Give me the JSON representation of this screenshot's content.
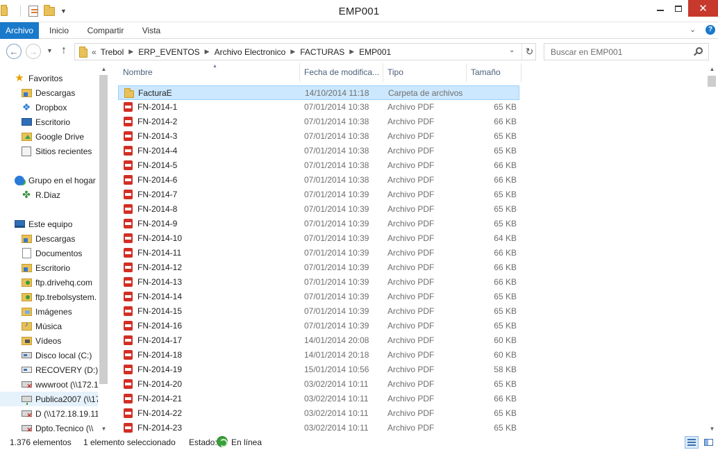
{
  "window": {
    "title": "EMP001",
    "close_glyph": "✕"
  },
  "ribbon": {
    "tabs": [
      "Archivo",
      "Inicio",
      "Compartir",
      "Vista"
    ]
  },
  "address": {
    "overflow": "«",
    "path": [
      "Trebol",
      "ERP_EVENTOS",
      "Archivo Electronico",
      "FACTURAS",
      "EMP001"
    ]
  },
  "search": {
    "placeholder": "Buscar en EMP001"
  },
  "nav": {
    "favorites_label": "Favoritos",
    "favorites": [
      "Descargas",
      "Dropbox",
      "Escritorio",
      "Google Drive",
      "Sitios recientes"
    ],
    "homegroup_label": "Grupo en el hogar",
    "homegroup_items": [
      "R.Diaz"
    ],
    "pc_label": "Este equipo",
    "pc_items": [
      "Descargas",
      "Documentos",
      "Escritorio",
      "ftp.drivehq.com",
      "ftp.trebolsystem.",
      "Imágenes",
      "Música",
      "Vídeos",
      "Disco local (C:)",
      "RECOVERY (D:)",
      "wwwroot (\\\\172.1",
      "Publica2007 (\\\\17",
      "D (\\\\172.18.19.11",
      "Dpto.Tecnico (\\\\"
    ]
  },
  "columns": {
    "name": "Nombre",
    "date": "Fecha de modifica...",
    "type": "Tipo",
    "size": "Tamaño"
  },
  "files": [
    {
      "name": "FacturaE",
      "date": "14/10/2014 11:18",
      "type": "Carpeta de archivos",
      "size": "",
      "kind": "folder",
      "selected": true
    },
    {
      "name": "FN-2014-1",
      "date": "07/01/2014 10:38",
      "type": "Archivo PDF",
      "size": "65 KB",
      "kind": "pdf"
    },
    {
      "name": "FN-2014-2",
      "date": "07/01/2014 10:38",
      "type": "Archivo PDF",
      "size": "66 KB",
      "kind": "pdf"
    },
    {
      "name": "FN-2014-3",
      "date": "07/01/2014 10:38",
      "type": "Archivo PDF",
      "size": "65 KB",
      "kind": "pdf"
    },
    {
      "name": "FN-2014-4",
      "date": "07/01/2014 10:38",
      "type": "Archivo PDF",
      "size": "65 KB",
      "kind": "pdf"
    },
    {
      "name": "FN-2014-5",
      "date": "07/01/2014 10:38",
      "type": "Archivo PDF",
      "size": "66 KB",
      "kind": "pdf"
    },
    {
      "name": "FN-2014-6",
      "date": "07/01/2014 10:38",
      "type": "Archivo PDF",
      "size": "66 KB",
      "kind": "pdf"
    },
    {
      "name": "FN-2014-7",
      "date": "07/01/2014 10:39",
      "type": "Archivo PDF",
      "size": "65 KB",
      "kind": "pdf"
    },
    {
      "name": "FN-2014-8",
      "date": "07/01/2014 10:39",
      "type": "Archivo PDF",
      "size": "65 KB",
      "kind": "pdf"
    },
    {
      "name": "FN-2014-9",
      "date": "07/01/2014 10:39",
      "type": "Archivo PDF",
      "size": "65 KB",
      "kind": "pdf"
    },
    {
      "name": "FN-2014-10",
      "date": "07/01/2014 10:39",
      "type": "Archivo PDF",
      "size": "64 KB",
      "kind": "pdf"
    },
    {
      "name": "FN-2014-11",
      "date": "07/01/2014 10:39",
      "type": "Archivo PDF",
      "size": "66 KB",
      "kind": "pdf"
    },
    {
      "name": "FN-2014-12",
      "date": "07/01/2014 10:39",
      "type": "Archivo PDF",
      "size": "66 KB",
      "kind": "pdf"
    },
    {
      "name": "FN-2014-13",
      "date": "07/01/2014 10:39",
      "type": "Archivo PDF",
      "size": "66 KB",
      "kind": "pdf"
    },
    {
      "name": "FN-2014-14",
      "date": "07/01/2014 10:39",
      "type": "Archivo PDF",
      "size": "65 KB",
      "kind": "pdf"
    },
    {
      "name": "FN-2014-15",
      "date": "07/01/2014 10:39",
      "type": "Archivo PDF",
      "size": "65 KB",
      "kind": "pdf"
    },
    {
      "name": "FN-2014-16",
      "date": "07/01/2014 10:39",
      "type": "Archivo PDF",
      "size": "65 KB",
      "kind": "pdf"
    },
    {
      "name": "FN-2014-17",
      "date": "14/01/2014 20:08",
      "type": "Archivo PDF",
      "size": "60 KB",
      "kind": "pdf"
    },
    {
      "name": "FN-2014-18",
      "date": "14/01/2014 20:18",
      "type": "Archivo PDF",
      "size": "60 KB",
      "kind": "pdf"
    },
    {
      "name": "FN-2014-19",
      "date": "15/01/2014 10:56",
      "type": "Archivo PDF",
      "size": "58 KB",
      "kind": "pdf"
    },
    {
      "name": "FN-2014-20",
      "date": "03/02/2014 10:11",
      "type": "Archivo PDF",
      "size": "65 KB",
      "kind": "pdf"
    },
    {
      "name": "FN-2014-21",
      "date": "03/02/2014 10:11",
      "type": "Archivo PDF",
      "size": "66 KB",
      "kind": "pdf"
    },
    {
      "name": "FN-2014-22",
      "date": "03/02/2014 10:11",
      "type": "Archivo PDF",
      "size": "65 KB",
      "kind": "pdf"
    },
    {
      "name": "FN-2014-23",
      "date": "03/02/2014 10:11",
      "type": "Archivo PDF",
      "size": "65 KB",
      "kind": "pdf"
    }
  ],
  "status": {
    "count": "1.376 elementos",
    "selected": "1 elemento seleccionado",
    "state_label": "Estado:",
    "state_value": "En línea"
  },
  "colors": {
    "accent": "#1979ca",
    "selection": "#cce8ff",
    "close": "#c7392c"
  }
}
